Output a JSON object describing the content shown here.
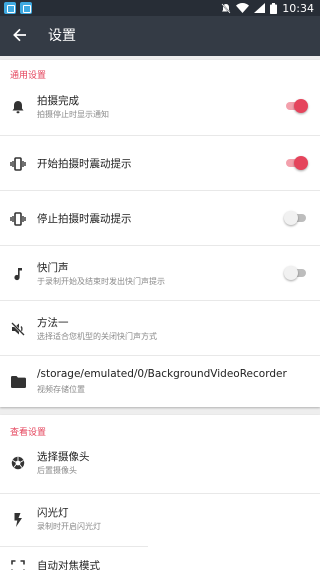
{
  "status_bar": {
    "time": "10:34",
    "icons": [
      "app-notification-icon",
      "app-notification-icon",
      "mute-icon",
      "wifi-icon",
      "signal-icon",
      "battery-icon"
    ]
  },
  "app_bar": {
    "title": "设置",
    "back_icon": "arrow-back-icon"
  },
  "colors": {
    "accent": "#e5445c",
    "app_bar": "#343b45",
    "status_bar": "#272d36"
  },
  "general": {
    "header": "通用设置",
    "items": [
      {
        "title": "拍摄完成",
        "subtitle": "拍摄停止时显示通知",
        "icon": "bell-icon",
        "toggle": true
      },
      {
        "title": "开始拍摄时震动提示",
        "subtitle": "",
        "icon": "vibrate-icon",
        "toggle": true
      },
      {
        "title": "停止拍摄时震动提示",
        "subtitle": "",
        "icon": "vibrate-icon",
        "toggle": false
      },
      {
        "title": "快门声",
        "subtitle": "于录制开始及结束时发出快门声提示",
        "icon": "music-note-icon",
        "toggle": false
      },
      {
        "title": "方法一",
        "subtitle": "选择适合您机型的关闭快门声方式",
        "icon": "volume-off-icon"
      },
      {
        "title": "/storage/emulated/0/BackgroundVideoRecorder",
        "subtitle": "视频存储位置",
        "icon": "folder-icon"
      }
    ]
  },
  "camera": {
    "header": "查看设置",
    "items": [
      {
        "title": "选择摄像头",
        "subtitle": "后置摄像头",
        "icon": "camera-iris-icon"
      },
      {
        "title": "闪光灯",
        "subtitle": "录制时开启闪光灯",
        "icon": "flash-icon"
      },
      {
        "title": "自动对焦模式",
        "subtitle": "",
        "icon": "focus-icon"
      }
    ]
  }
}
